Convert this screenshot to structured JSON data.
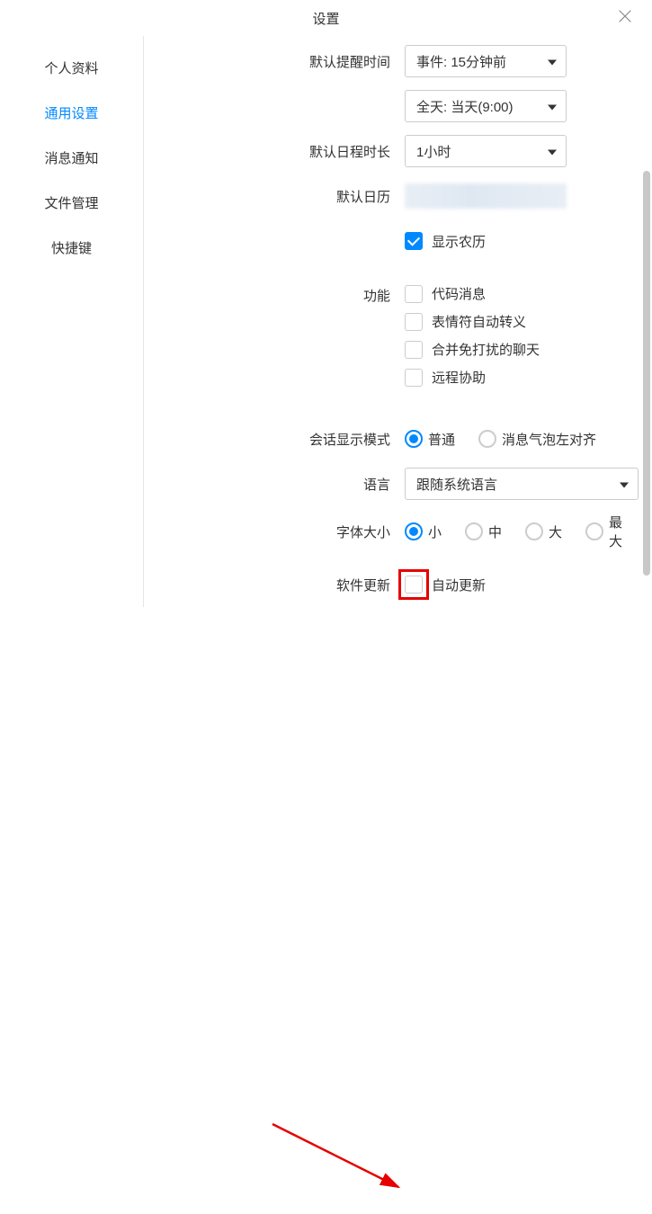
{
  "title": "设置",
  "sidebar": {
    "items": [
      {
        "label": "个人资料"
      },
      {
        "label": "通用设置"
      },
      {
        "label": "消息通知"
      },
      {
        "label": "文件管理"
      },
      {
        "label": "快捷键"
      }
    ],
    "activeIndex": 1
  },
  "reminder": {
    "label": "默认提醒时间",
    "event_value": "事件: 15分钟前",
    "allday_value": "全天: 当天(9:00)"
  },
  "duration": {
    "label": "默认日程时长",
    "value": "1小时"
  },
  "default_calendar": {
    "label": "默认日历"
  },
  "lunar": {
    "label": "显示农历",
    "checked": true
  },
  "features": {
    "label": "功能",
    "items": [
      {
        "label": "代码消息",
        "checked": false
      },
      {
        "label": "表情符自动转义",
        "checked": false
      },
      {
        "label": "合并免打扰的聊天",
        "checked": false
      },
      {
        "label": "远程协助",
        "checked": false
      }
    ]
  },
  "display_mode": {
    "label": "会话显示模式",
    "options": [
      {
        "label": "普通",
        "selected": true
      },
      {
        "label": "消息气泡左对齐",
        "selected": false
      }
    ]
  },
  "language": {
    "label": "语言",
    "value": "跟随系统语言"
  },
  "font_size": {
    "label": "字体大小",
    "options": [
      {
        "label": "小",
        "selected": true
      },
      {
        "label": "中",
        "selected": false
      },
      {
        "label": "大",
        "selected": false
      },
      {
        "label": "最大",
        "selected": false
      }
    ]
  },
  "software_update": {
    "label": "软件更新",
    "option_label": "自动更新",
    "checked": false
  }
}
